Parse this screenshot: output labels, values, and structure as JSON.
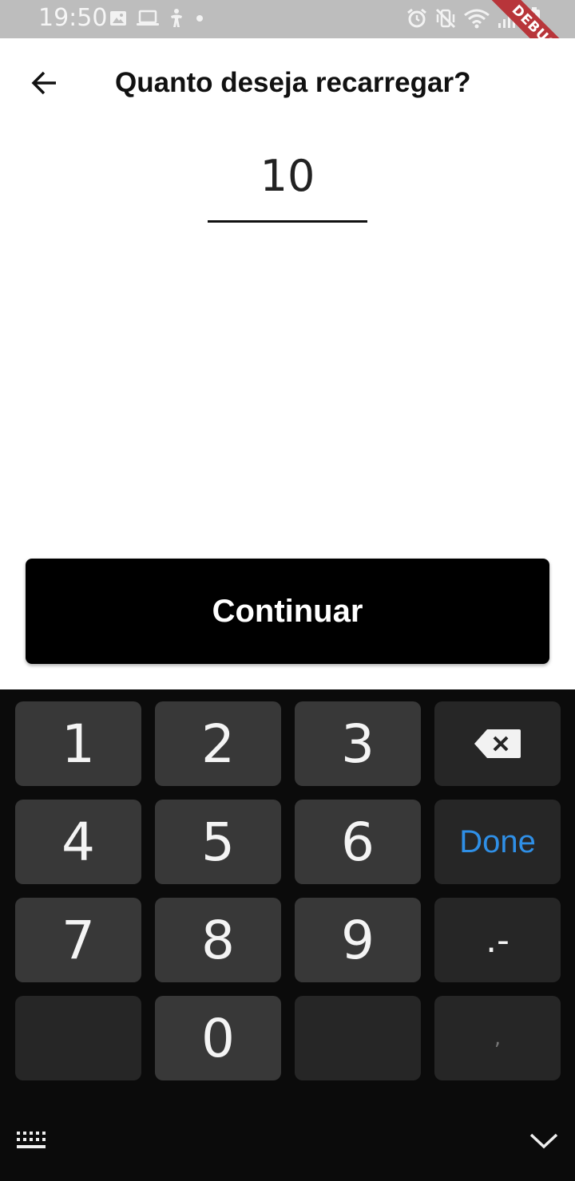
{
  "status_bar": {
    "time": "19:50",
    "left_icons": [
      "image-icon",
      "laptop-icon",
      "accessibility-icon",
      "dot-icon"
    ],
    "right_icons": [
      "alarm-icon",
      "vibrate-mute-icon",
      "wifi-icon",
      "signal-icon",
      "battery-charging-icon"
    ],
    "debug_banner": "DEBUG"
  },
  "app_bar": {
    "back_icon": "arrow-left-icon",
    "title": "Quanto deseja recarregar?"
  },
  "amount": {
    "value": "10"
  },
  "continue_button": {
    "label": "Continuar"
  },
  "keyboard": {
    "keys": {
      "k1": "1",
      "k2": "2",
      "k3": "3",
      "k4": "4",
      "k5": "5",
      "k6": "6",
      "k7": "7",
      "k8": "8",
      "k9": "9",
      "k0": "0",
      "done": "Done",
      "dot_dash": ".-",
      "comma": ","
    },
    "backspace_icon": "backspace-icon",
    "bottom_left_icon": "keyboard-icon",
    "bottom_right_icon": "chevron-down-icon"
  },
  "colors": {
    "status_bar_bg": "#bdbdbd",
    "debug_ribbon": "#b8353a",
    "button_bg": "#000000",
    "keyboard_bg": "#0b0b0b",
    "key_bg": "#383838",
    "done_text": "#2f8fe6"
  }
}
